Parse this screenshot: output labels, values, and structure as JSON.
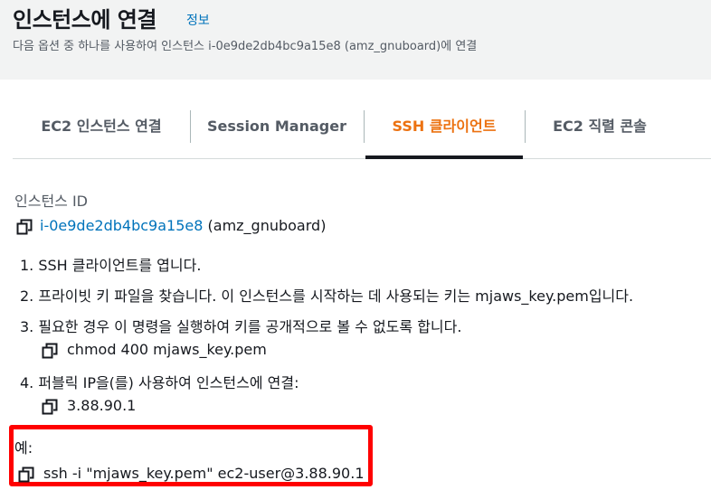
{
  "header": {
    "title": "인스턴스에 연결",
    "info_link": "정보",
    "subtitle": "다음 옵션 중 하나를 사용하여 인스턴스 i-0e9de2db4bc9a15e8 (amz_gnuboard)에 연결"
  },
  "tabs": [
    {
      "label": "EC2 인스턴스 연결",
      "active": false
    },
    {
      "label": "Session Manager",
      "active": false
    },
    {
      "label": "SSH 클라이언트",
      "active": true
    },
    {
      "label": "EC2 직렬 콘솔",
      "active": false
    }
  ],
  "instance": {
    "label": "인스턴스 ID",
    "id": "i-0e9de2db4bc9a15e8",
    "name": "(amz_gnuboard)"
  },
  "steps": {
    "step1": "1. SSH 클라이언트를 엽니다.",
    "step2": "2. 프라이빗 키 파일을 찾습니다. 이 인스턴스를 시작하는 데 사용되는 키는 mjaws_key.pem입니다.",
    "step3": "3. 필요한 경우 이 명령을 실행하여 키를 공개적으로 볼 수 없도록 합니다.",
    "step3_cmd": "chmod 400 mjaws_key.pem",
    "step4": "4. 퍼블릭 IP을(를) 사용하여 인스턴스에 연결:",
    "step4_ip": "3.88.90.1"
  },
  "example": {
    "label": "예:",
    "command": "ssh -i \"mjaws_key.pem\" ec2-user@3.88.90.1"
  },
  "colors": {
    "accent": "#ec7211",
    "link": "#0073bb",
    "highlight": "#ff0000"
  }
}
